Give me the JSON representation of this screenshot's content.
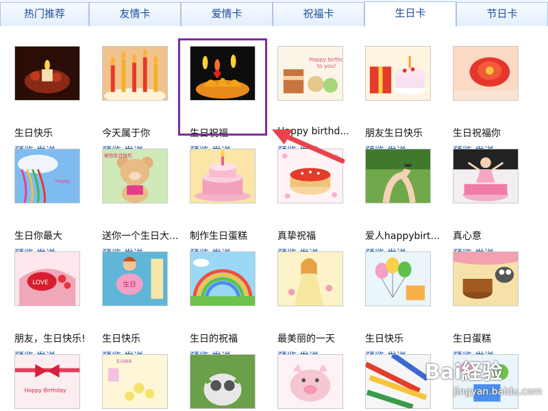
{
  "tabs": [
    {
      "label": "热门推荐",
      "active": false
    },
    {
      "label": "友情卡",
      "active": false
    },
    {
      "label": "爱情卡",
      "active": false
    },
    {
      "label": "祝福卡",
      "active": false
    },
    {
      "label": "生日卡",
      "active": true
    },
    {
      "label": "节日卡",
      "active": false
    }
  ],
  "actions": {
    "preview": "预览",
    "send": "发送"
  },
  "cards": [
    {
      "title": "生日快乐",
      "theme": "candle-dark"
    },
    {
      "title": "今天属于你",
      "theme": "candles"
    },
    {
      "title": "生日祝福",
      "theme": "cake-flames",
      "highlighted": true
    },
    {
      "title": "Happy birthd...",
      "theme": "cartoon-text"
    },
    {
      "title": "朋友生日快乐",
      "theme": "gift-cake"
    },
    {
      "title": "生日祝福你",
      "theme": "red-flower"
    },
    {
      "title": "生日你最大",
      "theme": "sky-ribbons"
    },
    {
      "title": "送你一个生日大...",
      "theme": "teddy"
    },
    {
      "title": "制作生日蛋糕",
      "theme": "pink-cake"
    },
    {
      "title": "真挚祝福",
      "theme": "cake-dots"
    },
    {
      "title": "爱人happybirt...",
      "theme": "hands-green"
    },
    {
      "title": "真心意",
      "theme": "dancer"
    },
    {
      "title": "朋友，生日快乐!",
      "theme": "love-cake"
    },
    {
      "title": "生日快乐",
      "theme": "cartoon-boy"
    },
    {
      "title": "生日的祝福",
      "theme": "rainbow"
    },
    {
      "title": "最美丽的一天",
      "theme": "girl"
    },
    {
      "title": "生日快乐",
      "theme": "balloons"
    },
    {
      "title": "生日蛋糕",
      "theme": "bug-cake"
    },
    {
      "title": "",
      "theme": "ribbon-card"
    },
    {
      "title": "",
      "theme": "flowers-card"
    },
    {
      "title": "",
      "theme": "kitten"
    },
    {
      "title": "",
      "theme": "pig"
    },
    {
      "title": "",
      "theme": "pencils"
    },
    {
      "title": "",
      "theme": "colorful"
    }
  ],
  "watermark": {
    "logo": "Bai経验",
    "sub": "jingyan.baidu.com"
  },
  "colors": {
    "tab_text": "#1d4f9a",
    "link": "#1a56a8",
    "highlight": "#7d2aa0",
    "arrow": "#e8434b"
  }
}
